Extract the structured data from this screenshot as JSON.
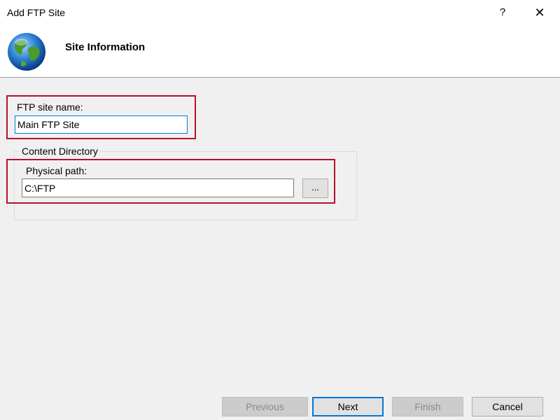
{
  "window": {
    "title": "Add FTP Site",
    "help_label": "?",
    "close_label": "✕"
  },
  "header": {
    "title": "Site Information",
    "icon": "globe-icon"
  },
  "form": {
    "site_name_label": "FTP site name:",
    "site_name_value": "Main FTP Site",
    "content_directory_legend": "Content Directory",
    "physical_path_label": "Physical path:",
    "physical_path_value": "C:\\FTP",
    "browse_label": "..."
  },
  "footer": {
    "previous_label": "Previous",
    "next_label": "Next",
    "finish_label": "Finish",
    "cancel_label": "Cancel"
  },
  "colors": {
    "highlight": "#b5112f",
    "focus": "#0078d7"
  }
}
